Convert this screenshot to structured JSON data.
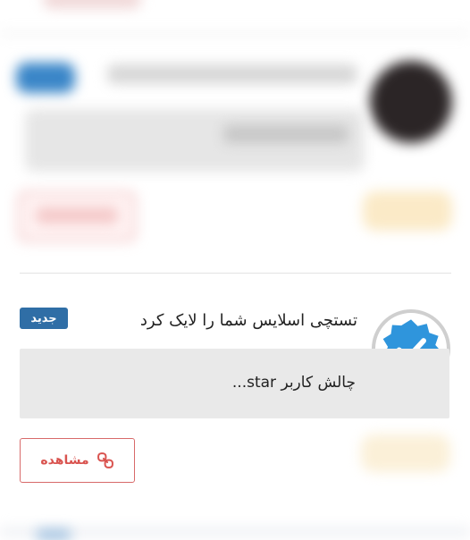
{
  "previous_card": {
    "note": ""
  },
  "notification": {
    "badge": "جدید",
    "title": "تستچی اسلایس شما را لایک کرد",
    "message": "چالش کاربر star...",
    "view_button": "مشاهده",
    "avatar_icon": "verified-check-icon",
    "link_icon": "link-icon"
  },
  "colors": {
    "badge_bg": "#2f6ea6",
    "verified_blue": "#2f95dc",
    "button_accent": "#d9534f",
    "message_bg": "#e9e9e9"
  }
}
